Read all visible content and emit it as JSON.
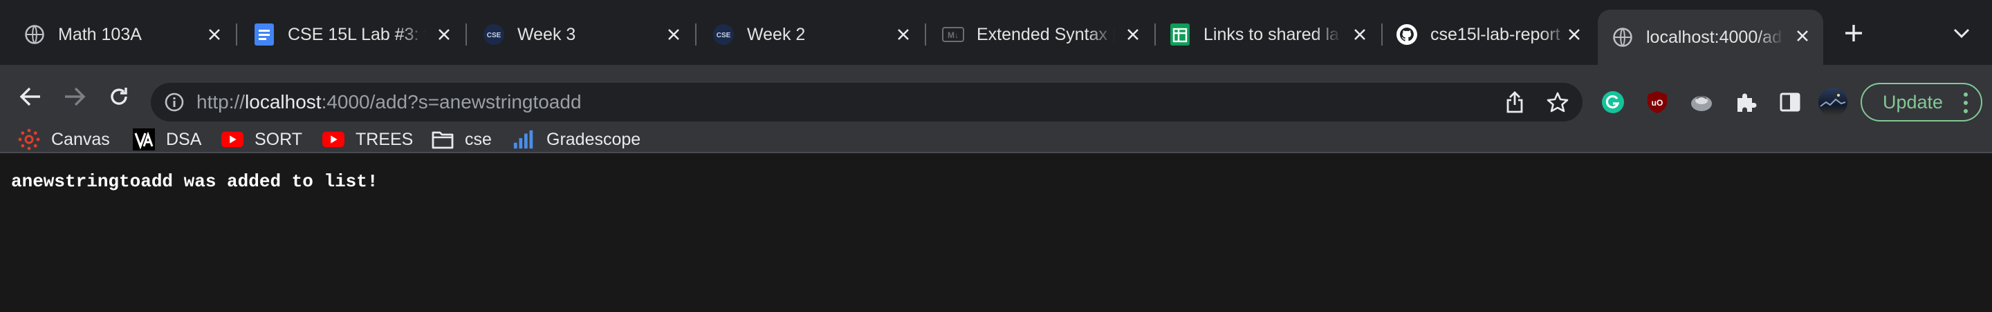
{
  "tabs": [
    {
      "title": "Math 103A",
      "favicon": "globe-icon"
    },
    {
      "title": "CSE 15L Lab #3: f",
      "favicon": "google-docs-icon"
    },
    {
      "title": "Week 3",
      "favicon": "cse-logo-icon",
      "favicon_text": "CSE"
    },
    {
      "title": "Week 2",
      "favicon": "cse-logo-icon",
      "favicon_text": "CSE"
    },
    {
      "title": "Extended Syntax |",
      "favicon": "markdown-icon",
      "favicon_text": "M↓"
    },
    {
      "title": "Links to shared la",
      "favicon": "google-sheets-icon"
    },
    {
      "title": "cse15l-lab-report",
      "favicon": "github-icon"
    },
    {
      "title": "localhost:4000/ad",
      "favicon": "globe-icon",
      "active": true
    }
  ],
  "address_bar": {
    "scheme": "http://",
    "host": "localhost",
    "rest": ":4000/add?s=anewstringtoadd"
  },
  "toolbar": {
    "update_label": "Update"
  },
  "bookmarks": [
    {
      "label": "Canvas",
      "icon": "canvas-icon"
    },
    {
      "label": "DSA",
      "icon": "visualgo-icon"
    },
    {
      "label": "SORT",
      "icon": "youtube-icon"
    },
    {
      "label": "TREES",
      "icon": "youtube-icon"
    },
    {
      "label": "cse",
      "icon": "folder-icon"
    },
    {
      "label": "Gradescope",
      "icon": "gradescope-icon"
    }
  ],
  "page": {
    "message": "anewstringtoadd was added to list!"
  },
  "colors": {
    "tabstrip_bg": "#1f2023",
    "toolbar_bg": "#35363a",
    "omnibox_bg": "#202124",
    "content_bg": "#181818",
    "update_green": "#81c995",
    "youtube_red": "#ff0000",
    "docs_blue": "#4285f4",
    "sheets_green": "#0f9d58"
  }
}
